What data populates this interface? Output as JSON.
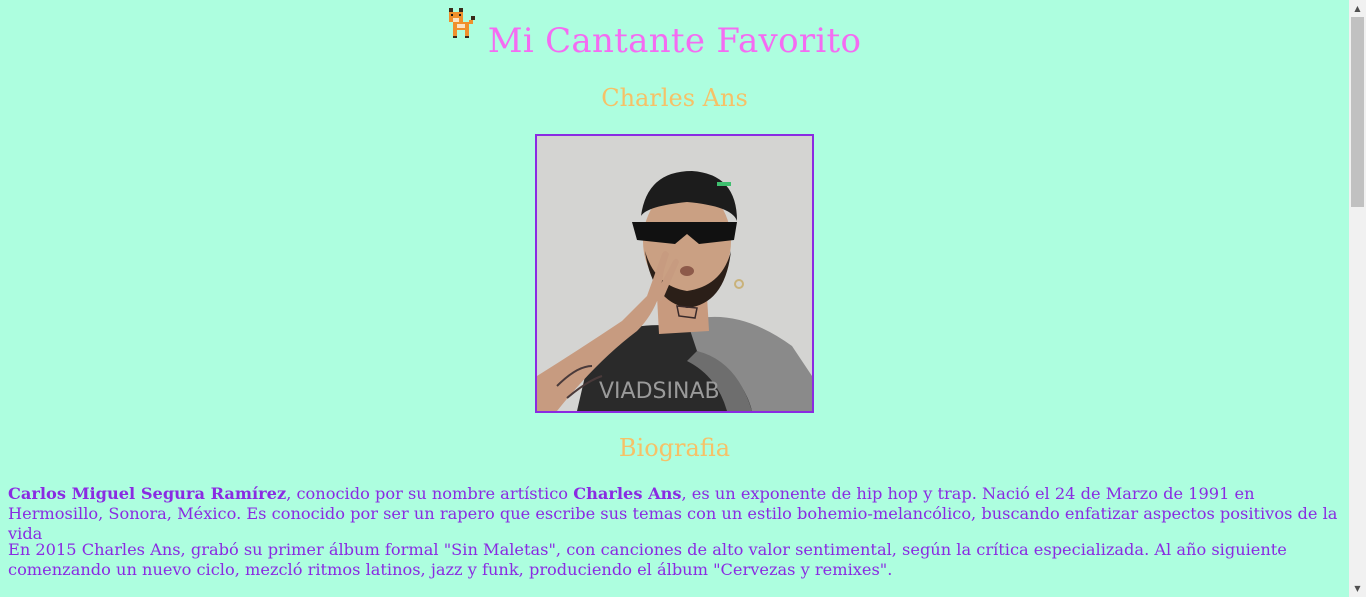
{
  "page": {
    "title": "Mi Cantante Favorito",
    "singer_name": "Charles Ans",
    "bio_heading": "Biografia",
    "photo_alt": "Charles Ans",
    "paragraph1": {
      "full_name": "Carlos Miguel Segura Ramírez",
      "text_a": ", conocido por su nombre artístico ",
      "stage_name": "Charles Ans",
      "text_b": ", es un exponente de hip hop y trap. Nació el 24 de Marzo de 1991 en Hermosillo, Sonora, México. Es conocido por ser un rapero que escribe sus temas con un estilo bohemio-melancólico, buscando enfatizar aspectos positivos de la vida"
    },
    "paragraph2": "En 2015 Charles Ans, grabó su primer álbum formal \"Sin Maletas\", con canciones de alto valor sentimental, según la crítica especializada. Al año siguiente comenzando un nuevo ciclo, mezcló ritmos latinos, jazz y funk, produciendo el álbum \"Cervezas y remixes\"."
  },
  "colors": {
    "background": "#adfedf",
    "title": "#f46cf2",
    "heading": "#f6c167",
    "text": "#8a2be2"
  },
  "icons": {
    "pet": "cat-cursor-icon",
    "scroll_up": "scroll-up-arrow-icon",
    "scroll_down": "scroll-down-arrow-icon"
  }
}
